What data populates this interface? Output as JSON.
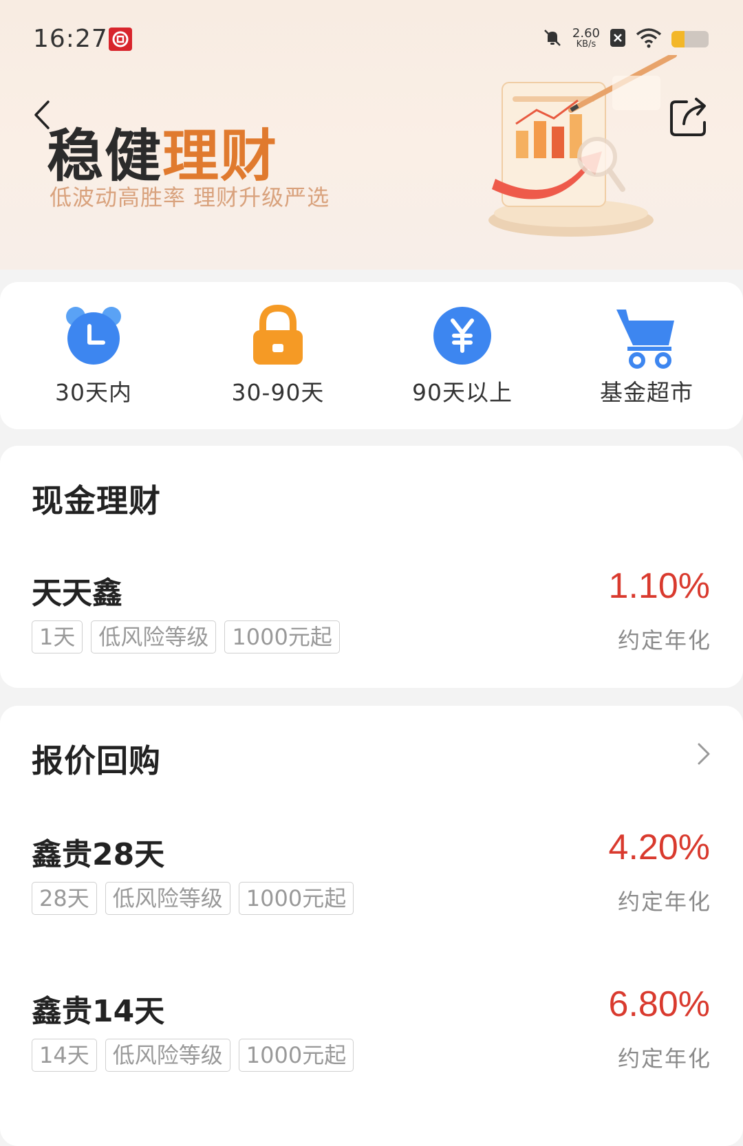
{
  "status_bar": {
    "time": "16:27",
    "net_speed_value": "2.60",
    "net_speed_unit": "KB/s",
    "battery_level": 0.35,
    "icons": [
      "carrier-icon",
      "mute-icon",
      "sim-off-icon",
      "wifi-icon",
      "battery-icon"
    ]
  },
  "header": {
    "title_dark": "稳健",
    "title_accent": "理财",
    "subtitle": "低波动高胜率   理财升级严选",
    "back_icon": "chevron-left-icon",
    "share_icon": "share-icon"
  },
  "categories": [
    {
      "label": "30天内",
      "icon": "alarm-clock-icon",
      "color": "#3d86f0"
    },
    {
      "label": "30-90天",
      "icon": "lock-icon",
      "color": "#f59a25"
    },
    {
      "label": "90天以上",
      "icon": "yen-coin-icon",
      "color": "#3d86f0"
    },
    {
      "label": "基金超市",
      "icon": "cart-icon",
      "color": "#3d86f0"
    }
  ],
  "sections": {
    "cash": {
      "title": "现金理财",
      "products": [
        {
          "name": "天天鑫",
          "rate": "1.10%",
          "rate_label": "约定年化",
          "tags": [
            "1天",
            "低风险等级",
            "1000元起"
          ]
        }
      ]
    },
    "repo": {
      "title": "报价回购",
      "more_icon": "chevron-right-icon",
      "products": [
        {
          "name": "鑫贵28天",
          "rate": "4.20%",
          "rate_label": "约定年化",
          "tags": [
            "28天",
            "低风险等级",
            "1000元起"
          ]
        },
        {
          "name": "鑫贵14天",
          "rate": "6.80%",
          "rate_label": "约定年化",
          "tags": [
            "14天",
            "低风险等级",
            "1000元起"
          ]
        }
      ]
    }
  },
  "colors": {
    "accent_orange": "#e07a2e",
    "rate_red": "#d93a2e",
    "hero_bg": "#f8ece2"
  }
}
